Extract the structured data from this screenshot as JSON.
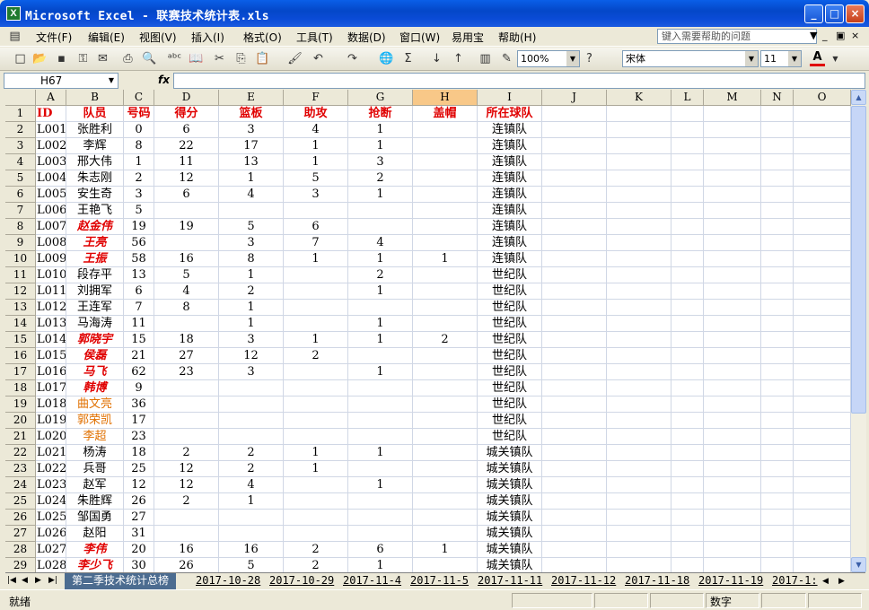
{
  "window": {
    "title": "Microsoft Excel - 联赛技术统计表.xls",
    "icon": "excel-icon",
    "buttons": {
      "minimize": "_",
      "maximize": "□",
      "close": "×"
    }
  },
  "menu": {
    "items": [
      "文件(F)",
      "编辑(E)",
      "视图(V)",
      "插入(I)",
      "格式(O)",
      "工具(T)",
      "数据(D)",
      "窗口(W)",
      "易用宝",
      "帮助(H)"
    ],
    "help_placeholder": "键入需要帮助的问题"
  },
  "toolbar": {
    "zoom": "100%",
    "font": "宋体",
    "font_size": "11",
    "font_color_label": "A"
  },
  "formula_bar": {
    "name_box": "H67",
    "fx_label": "fx",
    "formula": ""
  },
  "sheet": {
    "selected_column": "H",
    "columns": [
      "A",
      "B",
      "C",
      "D",
      "E",
      "F",
      "G",
      "H",
      "I",
      "J",
      "K",
      "L",
      "M",
      "N",
      "O"
    ],
    "rows": [
      {
        "n": "1",
        "cells": [
          "ID",
          "队员",
          "号码",
          "得分",
          "篮板",
          "助攻",
          "抢断",
          "盖帽",
          "所在球队"
        ],
        "style": "header"
      },
      {
        "n": "2",
        "cells": [
          "L001",
          "张胜利",
          "0",
          "6",
          "3",
          "4",
          "1",
          "",
          "连镇队"
        ]
      },
      {
        "n": "3",
        "cells": [
          "L002",
          "李辉",
          "8",
          "22",
          "17",
          "1",
          "1",
          "",
          "连镇队"
        ]
      },
      {
        "n": "4",
        "cells": [
          "L003",
          "邢大伟",
          "1",
          "11",
          "13",
          "1",
          "3",
          "",
          "连镇队"
        ]
      },
      {
        "n": "5",
        "cells": [
          "L004",
          "朱志刚",
          "2",
          "12",
          "1",
          "5",
          "2",
          "",
          "连镇队"
        ]
      },
      {
        "n": "6",
        "cells": [
          "L005",
          "安生奇",
          "3",
          "6",
          "4",
          "3",
          "1",
          "",
          "连镇队"
        ]
      },
      {
        "n": "7",
        "cells": [
          "L006",
          "王艳飞",
          "5",
          "",
          "",
          "",
          "",
          "",
          "连镇队"
        ]
      },
      {
        "n": "8",
        "cells": [
          "L007",
          "赵金伟",
          "19",
          "19",
          "5",
          "6",
          "",
          "",
          "连镇队"
        ],
        "style": "red"
      },
      {
        "n": "9",
        "cells": [
          "L008",
          "王亮",
          "56",
          "",
          "3",
          "7",
          "4",
          "",
          "连镇队"
        ],
        "style": "red"
      },
      {
        "n": "10",
        "cells": [
          "L009",
          "王振",
          "58",
          "16",
          "8",
          "1",
          "1",
          "1",
          "连镇队"
        ],
        "style": "red"
      },
      {
        "n": "11",
        "cells": [
          "L010",
          "段存平",
          "13",
          "5",
          "1",
          "",
          "2",
          "",
          "世纪队"
        ]
      },
      {
        "n": "12",
        "cells": [
          "L011",
          "刘拥军",
          "6",
          "4",
          "2",
          "",
          "1",
          "",
          "世纪队"
        ]
      },
      {
        "n": "13",
        "cells": [
          "L012",
          "王连军",
          "7",
          "8",
          "1",
          "",
          "",
          "",
          "世纪队"
        ]
      },
      {
        "n": "14",
        "cells": [
          "L013",
          "马海涛",
          "11",
          "",
          "1",
          "",
          "1",
          "",
          "世纪队"
        ]
      },
      {
        "n": "15",
        "cells": [
          "L014",
          "郭晓宇",
          "15",
          "18",
          "3",
          "1",
          "1",
          "2",
          "世纪队"
        ],
        "style": "red"
      },
      {
        "n": "16",
        "cells": [
          "L015",
          "侯磊",
          "21",
          "27",
          "12",
          "2",
          "",
          "",
          "世纪队"
        ],
        "style": "red"
      },
      {
        "n": "17",
        "cells": [
          "L016",
          "马飞",
          "62",
          "23",
          "3",
          "",
          "1",
          "",
          "世纪队"
        ],
        "style": "red"
      },
      {
        "n": "18",
        "cells": [
          "L017",
          "韩博",
          "9",
          "",
          "",
          "",
          "",
          "",
          "世纪队"
        ],
        "style": "red"
      },
      {
        "n": "19",
        "cells": [
          "L018",
          "曲文亮",
          "36",
          "",
          "",
          "",
          "",
          "",
          "世纪队"
        ],
        "style": "orange"
      },
      {
        "n": "20",
        "cells": [
          "L019",
          "郭荣凯",
          "17",
          "",
          "",
          "",
          "",
          "",
          "世纪队"
        ],
        "style": "orange"
      },
      {
        "n": "21",
        "cells": [
          "L020",
          "李超",
          "23",
          "",
          "",
          "",
          "",
          "",
          "世纪队"
        ],
        "style": "orange"
      },
      {
        "n": "22",
        "cells": [
          "L021",
          "杨涛",
          "18",
          "2",
          "2",
          "1",
          "1",
          "",
          "城关镇队"
        ]
      },
      {
        "n": "23",
        "cells": [
          "L022",
          "兵哥",
          "25",
          "12",
          "2",
          "1",
          "",
          "",
          "城关镇队"
        ]
      },
      {
        "n": "24",
        "cells": [
          "L023",
          "赵军",
          "12",
          "12",
          "4",
          "",
          "1",
          "",
          "城关镇队"
        ]
      },
      {
        "n": "25",
        "cells": [
          "L024",
          "朱胜辉",
          "26",
          "2",
          "1",
          "",
          "",
          "",
          "城关镇队"
        ]
      },
      {
        "n": "26",
        "cells": [
          "L025",
          "邹国勇",
          "27",
          "",
          "",
          "",
          "",
          "",
          "城关镇队"
        ]
      },
      {
        "n": "27",
        "cells": [
          "L026",
          "赵阳",
          "31",
          "",
          "",
          "",
          "",
          "",
          "城关镇队"
        ]
      },
      {
        "n": "28",
        "cells": [
          "L027",
          "李伟",
          "20",
          "16",
          "16",
          "2",
          "6",
          "1",
          "城关镇队"
        ],
        "style": "red"
      },
      {
        "n": "29",
        "cells": [
          "L028",
          "李少飞",
          "30",
          "26",
          "5",
          "2",
          "1",
          "",
          "城关镇队"
        ],
        "style": "red"
      }
    ]
  },
  "tabs": [
    "第二季技术统计总榜",
    "2017-10-28",
    "2017-10-29",
    "2017-11-4",
    "2017-11-5",
    "2017-11-11",
    "2017-11-12",
    "2017-11-18",
    "2017-11-19",
    "2017-1:"
  ],
  "status": {
    "ready": "就绪",
    "num": "数字"
  }
}
